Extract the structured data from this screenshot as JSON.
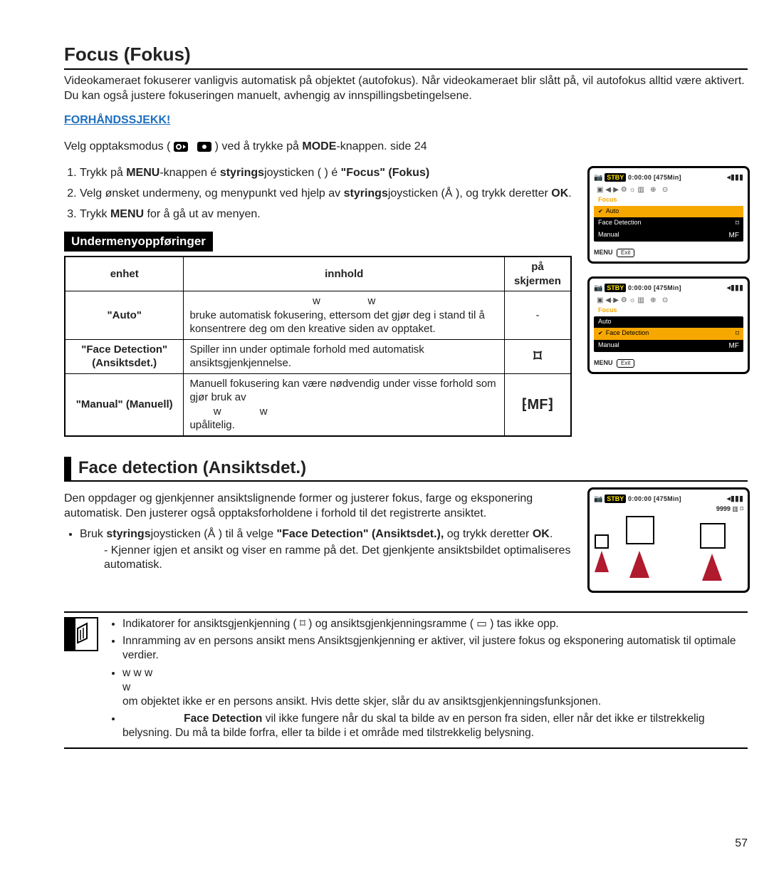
{
  "page_number": "57",
  "title": "Focus (Fokus)",
  "intro": "Videokameraet fokuserer vanligvis automatisk på objektet (autofokus). Når videokameraet blir slått på, vil autofokus alltid være aktivert. Du kan også justere fokuseringen manuelt, avhengig av innspillingsbetingelsene.",
  "precheck_label": "FORHÅNDSSJEKK!",
  "modeline_a": "Velg opptaksmodus ( ",
  "modeline_b": " ) ved å trykke på ",
  "modeline_mode": "MODE",
  "modeline_c": "-knappen.  side 24",
  "steps": [
    {
      "pre": "Trykk på ",
      "b1": "MENU",
      "mid": "-knappen é  ",
      "b2": "styrings",
      "mid2": "joysticken (  ) é  ",
      "b3": "\"Focus\" (Fokus)",
      "post": ""
    },
    {
      "pre": "Velg ønsket undermeny, og menypunkt ved hjelp av ",
      "b1": "styrings",
      "mid": "joysticken (Å  ), og trykk deretter ",
      "b2": "OK",
      "post": ".",
      "b3": "",
      "mid2": ""
    },
    {
      "pre": "Trykk ",
      "b1": "MENU",
      "mid": " for å gå ut av menyen.",
      "b2": "",
      "post": "",
      "b3": "",
      "mid2": ""
    }
  ],
  "submenu_hdr": "Undermenyoppføringer",
  "table": {
    "h_enhet": "enhet",
    "h_innhold": "innhold",
    "h_skjerm": "på skjermen",
    "rows": [
      {
        "enhet": "\"Auto\"",
        "innhold": "w            w\nbruke automatisk fokusering, ettersom det gjør deg i stand til å konsentrere deg om den kreative siden av opptaket.",
        "skjerm": "-"
      },
      {
        "enhet": "\"Face Detection\" (Ansiktsdet.)",
        "innhold": "Spiller inn under optimale forhold med automatisk ansiktsgjenkjennelse.",
        "skjerm": "face"
      },
      {
        "enhet": "\"Manual\" (Manuell)",
        "innhold": "Manuell fokusering kan være nødvendig under visse forhold som gjør bruk av w         w upålitelig.",
        "skjerm": "mf"
      }
    ]
  },
  "h2": "Face detection (Ansiktsdet.)",
  "facepara": "Den oppdager og gjenkjenner ansiktslignende former og justerer fokus, farge og eksponering automatisk. Den justerer også opptaksforholdene i forhold til det registrerte ansiktet.",
  "facebullet_a": "Bruk ",
  "facebullet_b": "styrings",
  "facebullet_c": "joysticken (Å  ) til å velge ",
  "facebullet_d": "\"Face Detection\" (Ansiktsdet.),",
  "facebullet_e": " og trykk deretter ",
  "facebullet_f": "OK",
  "facebullet_g": ".",
  "facedash": "Kjenner igjen et ansikt og viser en ramme på det. Det gjenkjente ansiktsbildet optimaliseres automatisk.",
  "notes": [
    "Indikatorer for ansiktsgjenkjenning ( ⌑ ) og ansiktsgjenkjenningsramme ( ▭ ) tas ikke opp.",
    "Innramming av en persons ansikt mens Ansiktsgjenkjenning er aktiver, vil justere fokus og eksponering automatisk til optimale verdier.",
    "w                                   w                        w\n                                                             w\nom objektet ikke er en persons ansikt. Hvis dette skjer, slår du av ansiktsgjenkjenningsfunksjonen.",
    "Face Detection vil ikke fungere når du skal ta bilde av en person fra siden, eller når det ikke er tilstrekkelig belysning. Du må ta bilde forfra, eller ta bilde i et område med tilstrekkelig belysning."
  ],
  "note_bold": "Face Detection",
  "lcd": {
    "stby": "STBY",
    "time": "0:00:00",
    "remain": "[475Min]",
    "focus": "Focus",
    "auto": "Auto",
    "facedet": "Face Detection",
    "manual": "Manual",
    "menu": "MENU",
    "exit": "Exit",
    "photocount": "9999"
  }
}
